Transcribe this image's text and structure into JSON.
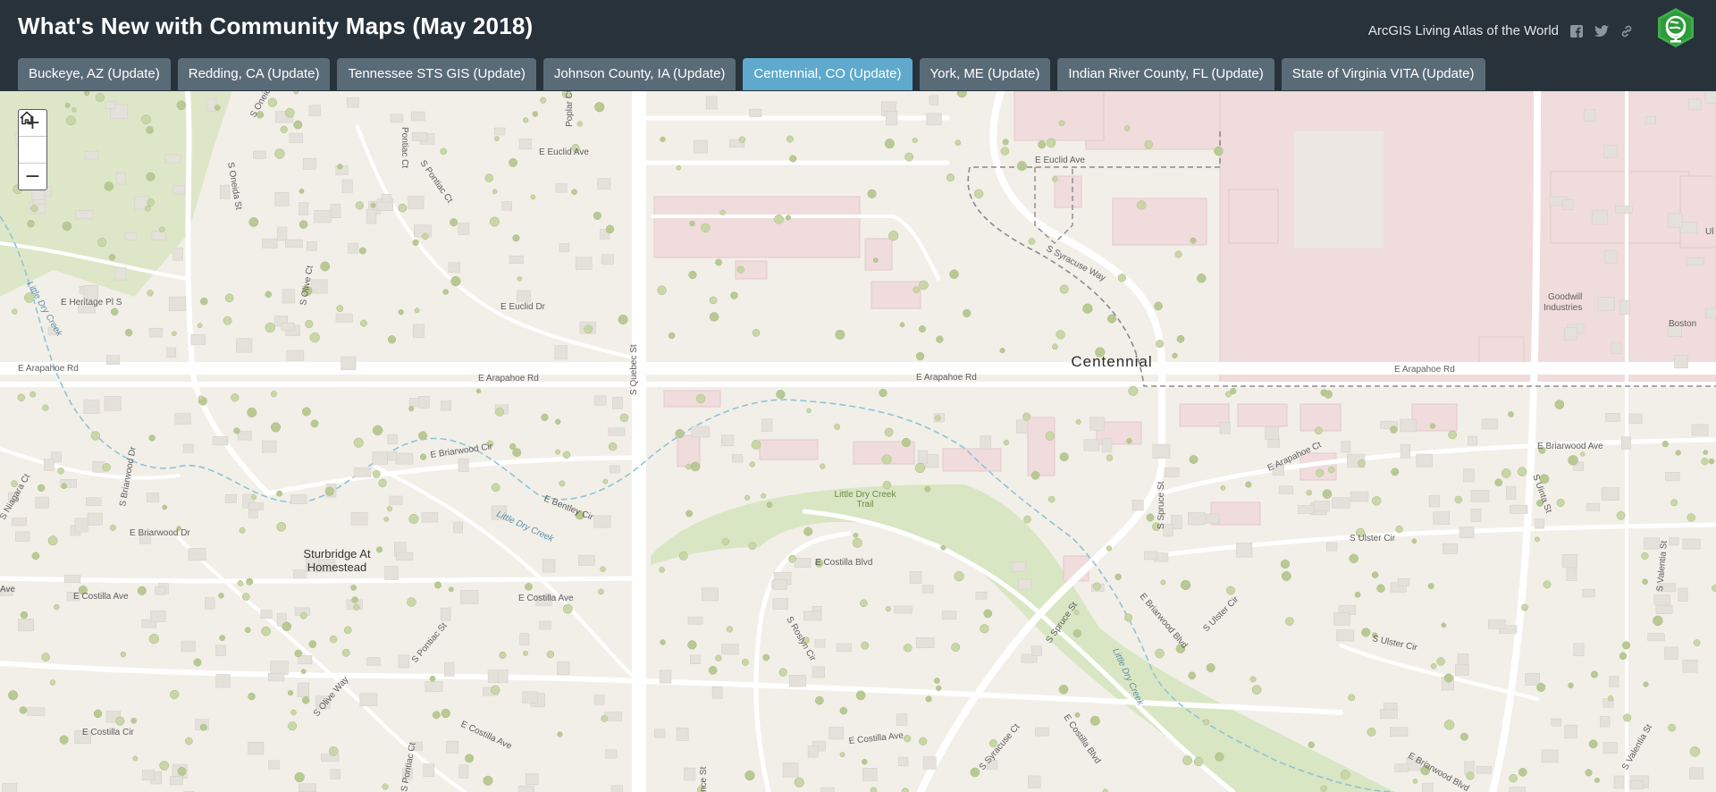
{
  "page": {
    "title": "What's New with Community Maps (May 2018)"
  },
  "header": {
    "atlas_link": "ArcGIS Living Atlas of the World",
    "social_icons": [
      "facebook-icon",
      "twitter-icon",
      "link-icon"
    ],
    "logo_icon": "living-atlas-globe-icon"
  },
  "tabs": [
    {
      "label": "Buckeye, AZ (Update)",
      "active": false
    },
    {
      "label": "Redding, CA (Update)",
      "active": false
    },
    {
      "label": "Tennessee STS GIS (Update)",
      "active": false
    },
    {
      "label": "Johnson County, IA (Update)",
      "active": false
    },
    {
      "label": "Centennial, CO (Update)",
      "active": true
    },
    {
      "label": "York, ME (Update)",
      "active": false
    },
    {
      "label": "Indian River County, FL (Update)",
      "active": false
    },
    {
      "label": "State of Virginia VITA (Update)",
      "active": false
    }
  ],
  "map_controls": {
    "zoom_in": "+",
    "home": "⌂",
    "zoom_out": "−"
  },
  "map_labels": {
    "city": "Centennial",
    "place_sturbridge_1": "Sturbridge At",
    "place_sturbridge_2": "Homestead",
    "goodwill_1": "Goodwill",
    "goodwill_2": "Industries",
    "boston": "Boston",
    "trail_1": "Little Dry Creek",
    "trail_2": "Trail",
    "arapahoe_w": "E Arapahoe Rd",
    "arapahoe_c": "E Arapahoe Rd",
    "arapahoe_e": "E Arapahoe Rd",
    "arapahoe_fe": "E Arapahoe Rd",
    "euclid_ave_w": "E Euclid Ave",
    "euclid_ave_e": "E Euclid Ave",
    "euclid_dr": "E Euclid Dr",
    "heritage": "E Heritage Pl S",
    "briarwood_cir": "E Briarwood Cir",
    "briarwood_dr": "E Briarwood Dr",
    "briarwood_ave": "E Briarwood Ave",
    "briarwood_blvd": "E Briarwood Blvd",
    "briarwood_blvd2": "E Briarwood Blvd",
    "costilla_ave_w": "E Costilla Ave",
    "costilla_ave_c": "E Costilla Ave",
    "costilla_ave_s": "E Costilla Ave",
    "costilla_ave_m": "E Costilla Ave",
    "costilla_blvd": "E Costilla Blvd",
    "costilla_blvd2": "E Costilla Blvd",
    "costilla_cir": "E Costilla Cir",
    "bentley": "E Bentley Cir",
    "arapahoe_ct": "E Arapahoe Ct",
    "ulster_cir": "S Ulster Cir",
    "ulster_cir2": "S Ulster Cir",
    "ulster_cir3": "S Ulster Cir",
    "quebec": "S Quebec St",
    "oneida": "S Oneida St",
    "oneida2": "S Oneida",
    "pontiac_ct": "S Pontiac Ct",
    "pontiac_ct2": "S Pontiac Ct",
    "pontiac_st": "S Pontiac St",
    "pontiac_ct3": "S Pontiac Ct",
    "olive_ct": "S Olive Ct",
    "olive_way": "S Olive Way",
    "poplar": "Poplar Ct",
    "pontiac_top": "Pontiac Ct",
    "spruce": "S Spruce St",
    "spruce2": "S Spruce St",
    "syracuse": "S Syracuse Way",
    "syracuse_ct": "S Syracuse Ct",
    "uinta": "S Uinta St",
    "valentia": "S Valentia St",
    "valentia2": "S Valentia St",
    "niagara": "S Niagara Ct",
    "briarwood_dr_v": "S Briarwood Dr",
    "roslyn": "S Roslyn Cir",
    "little_dry_creek_1": "Little Dry Creek",
    "little_dry_creek_2": "Little Dry Creek",
    "little_dry_creek_3": "Little Dry Creek",
    "ave_edge": "Ave",
    "ulinta_edge": "Ul",
    "quince": "nce St"
  },
  "colors": {
    "header_bg": "#27323b",
    "tab_bg": "#5a6b78",
    "tab_active": "#5fa9cc",
    "map_bg": "#f2efe9",
    "park": "#d9e6c3",
    "commercial": "#f2dede",
    "creek": "#8ec3d6"
  }
}
